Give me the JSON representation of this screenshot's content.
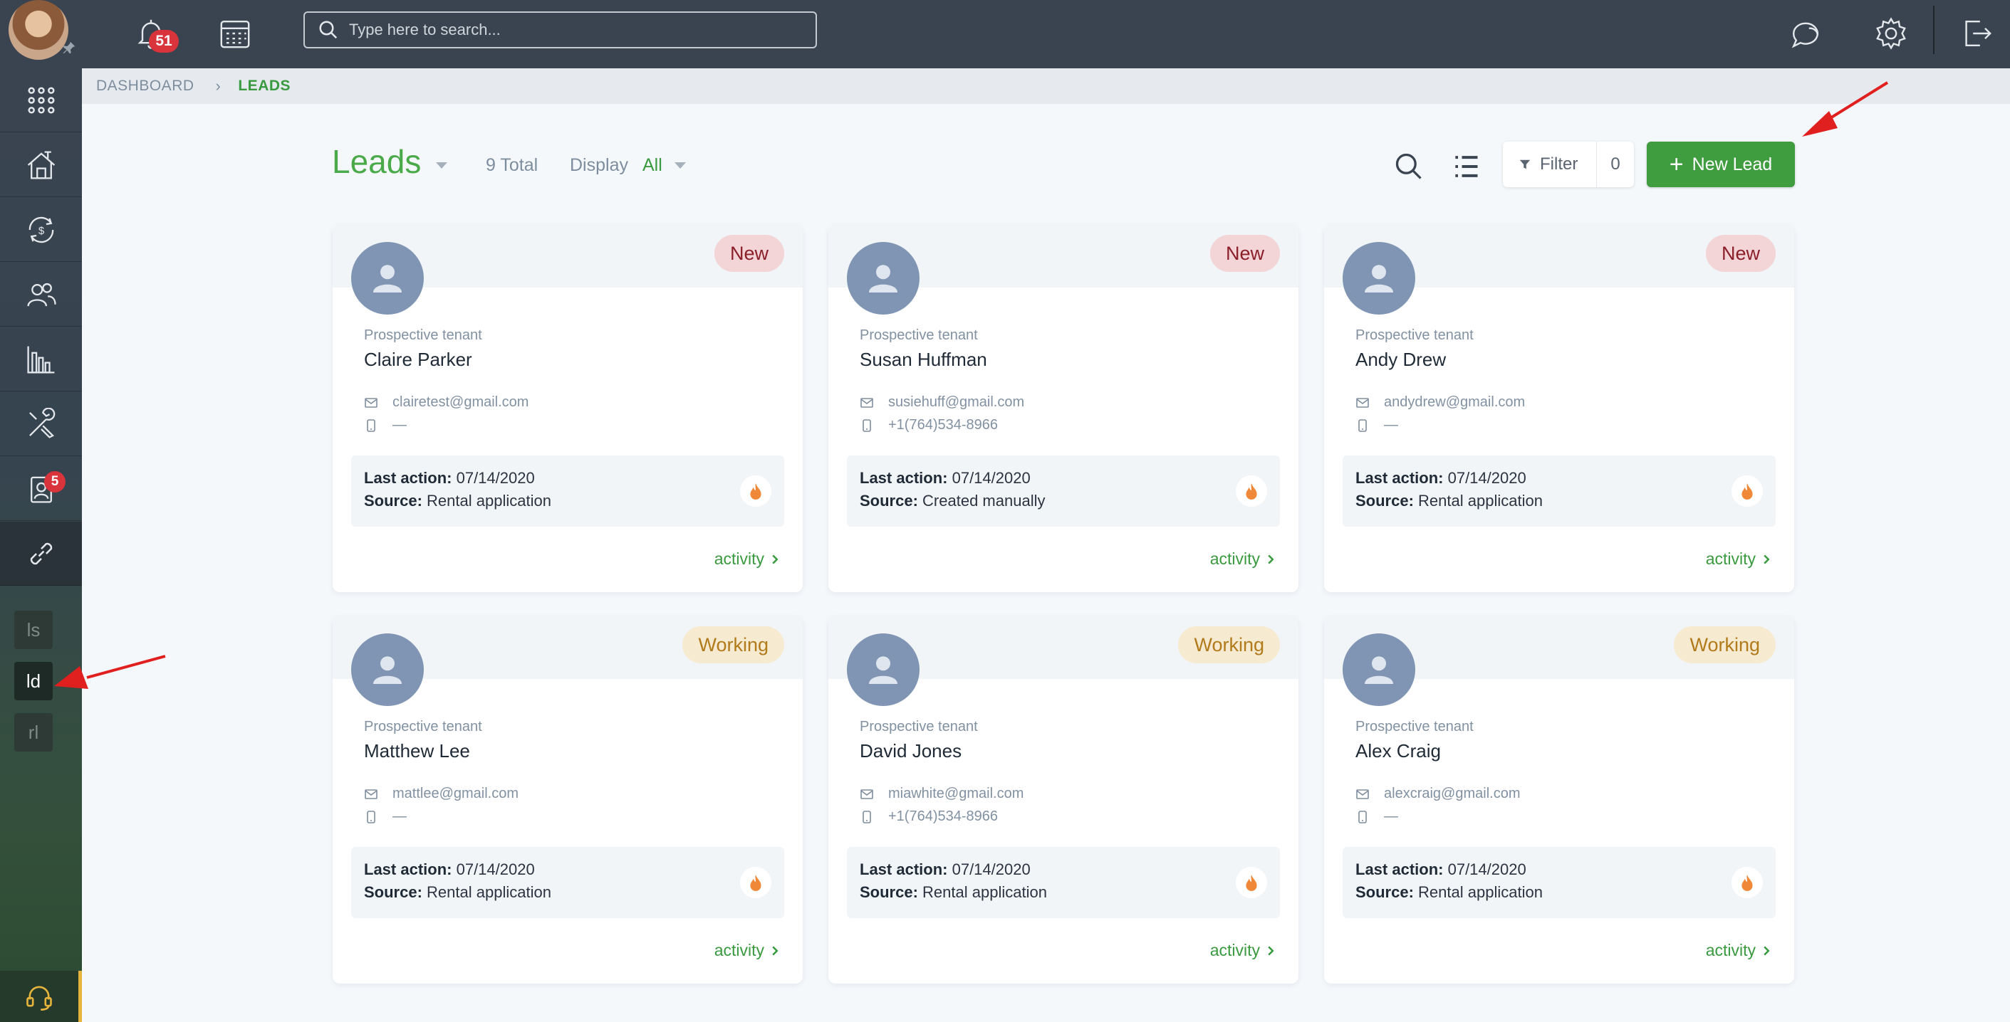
{
  "topbar": {
    "notifications_count": "51",
    "search_placeholder": "Type here to search..."
  },
  "sidebar": {
    "tasks_badge": "5",
    "sub_items": [
      "ls",
      "ld",
      "rl"
    ],
    "active_sub_item": "ld"
  },
  "breadcrumb": {
    "items": [
      "DASHBOARD",
      "LEADS"
    ]
  },
  "header": {
    "title": "Leads",
    "total": "9 Total",
    "display_label": "Display",
    "display_value": "All",
    "filter_label": "Filter",
    "filter_count": "0",
    "new_lead_label": "New Lead"
  },
  "labels": {
    "last_action": "Last action:",
    "source": "Source:",
    "activity": "activity"
  },
  "leads": [
    {
      "status": "New",
      "role": "Prospective tenant",
      "name": "Claire Parker",
      "email": "clairetest@gmail.com",
      "phone": "—",
      "last_action": "07/14/2020",
      "source": "Rental application"
    },
    {
      "status": "New",
      "role": "Prospective tenant",
      "name": "Susan Huffman",
      "email": "susiehuff@gmail.com",
      "phone": "+1(764)534-8966",
      "last_action": "07/14/2020",
      "source": "Created manually"
    },
    {
      "status": "New",
      "role": "Prospective tenant",
      "name": "Andy Drew",
      "email": "andydrew@gmail.com",
      "phone": "—",
      "last_action": "07/14/2020",
      "source": "Rental application"
    },
    {
      "status": "Working",
      "role": "Prospective tenant",
      "name": "Matthew Lee",
      "email": "mattlee@gmail.com",
      "phone": "—",
      "last_action": "07/14/2020",
      "source": "Rental application"
    },
    {
      "status": "Working",
      "role": "Prospective tenant",
      "name": "David Jones",
      "email": "miawhite@gmail.com",
      "phone": "+1(764)534-8966",
      "last_action": "07/14/2020",
      "source": "Rental application"
    },
    {
      "status": "Working",
      "role": "Prospective tenant",
      "name": "Alex Craig",
      "email": "alexcraig@gmail.com",
      "phone": "—",
      "last_action": "07/14/2020",
      "source": "Rental application"
    }
  ],
  "colors": {
    "accent_green": "#3f9c3f",
    "sidebar_bg": "#3a4450",
    "badge_red": "#d9343c",
    "annotation_arrow": "#e0201e"
  }
}
